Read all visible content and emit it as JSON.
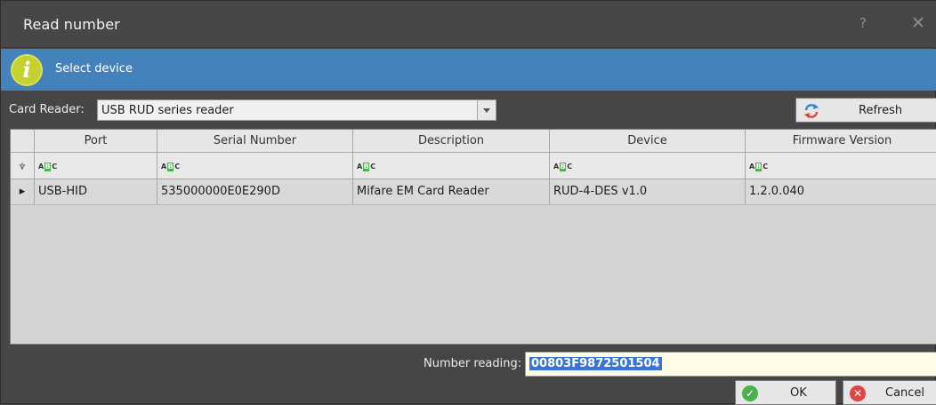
{
  "window": {
    "title": "Read number",
    "help_glyph": "?",
    "close_glyph": "✕"
  },
  "banner": {
    "icon": "info-icon",
    "icon_glyph": "i",
    "text": "Select device",
    "color": "#4382ba"
  },
  "card_reader": {
    "label": "Card Reader:",
    "selected": "USB RUD series reader"
  },
  "refresh": {
    "label": "Refresh",
    "icon": "refresh-icon"
  },
  "grid": {
    "columns": [
      "Port",
      "Serial Number",
      "Description",
      "Device",
      "Firmware Version"
    ],
    "filter_icon": "abc-filter-icon",
    "filter_glyph": "ABC",
    "rows": [
      {
        "port": "USB-HID",
        "serial": "535000000E0E290D",
        "description": "Mifare EM Card Reader",
        "device": "RUD-4-DES v1.0",
        "firmware": "1.2.0.040"
      }
    ]
  },
  "number_reading": {
    "label": "Number reading:",
    "value": "00803F9872501504"
  },
  "buttons": {
    "ok": "OK",
    "cancel": "Cancel"
  }
}
